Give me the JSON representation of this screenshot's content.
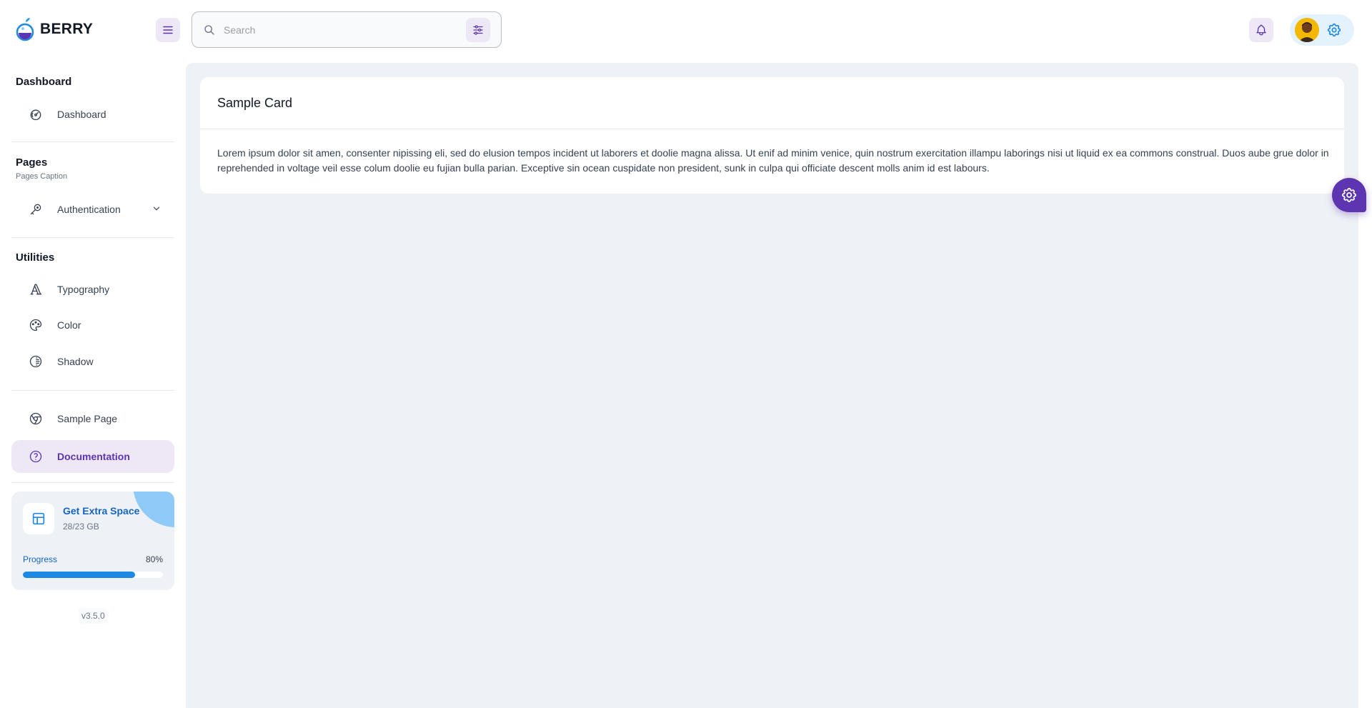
{
  "app": {
    "logo_text": "BERRY"
  },
  "header": {
    "search_placeholder": "Search"
  },
  "sidebar": {
    "groups": [
      {
        "title": "Dashboard",
        "items": [
          {
            "label": "Dashboard",
            "icon": "dashboard-icon"
          }
        ]
      },
      {
        "title": "Pages",
        "caption": "Pages Caption",
        "items": [
          {
            "label": "Authentication",
            "icon": "key-icon"
          }
        ]
      },
      {
        "title": "Utilities",
        "items": [
          {
            "label": "Typography",
            "icon": "typography-icon"
          },
          {
            "label": "Color",
            "icon": "palette-icon"
          },
          {
            "label": "Shadow",
            "icon": "shadow-icon"
          }
        ]
      },
      {
        "items": [
          {
            "label": "Sample Page",
            "icon": "brand-chrome-icon"
          },
          {
            "label": "Documentation",
            "icon": "help-icon",
            "active": true
          }
        ]
      }
    ],
    "space_card": {
      "title": "Get Extra Space",
      "subtitle": "28/23 GB",
      "progress_label": "Progress",
      "progress_text": "80%",
      "progress": 0.8
    },
    "version": "v3.5.0"
  },
  "main": {
    "card_title": "Sample Card",
    "card_body": "Lorem ipsum dolor sit amen, consenter nipissing eli, sed do elusion tempos incident ut laborers et doolie magna alissa. Ut enif ad minim venice, quin nostrum exercitation illampu laborings nisi ut liquid ex ea commons construal. Duos aube grue dolor in reprehended in voltage veil esse colum doolie eu fujian bulla parian. Exceptive sin ocean cuspidate non president, sunk in culpa qui officiate descent molls anim id est labours."
  },
  "colors": {
    "primary": "#5e35b1",
    "primary_light": "#ede7f6",
    "secondary": "#1e88e5",
    "secondary_light": "#e3f2fd",
    "background": "#eef2f6"
  }
}
